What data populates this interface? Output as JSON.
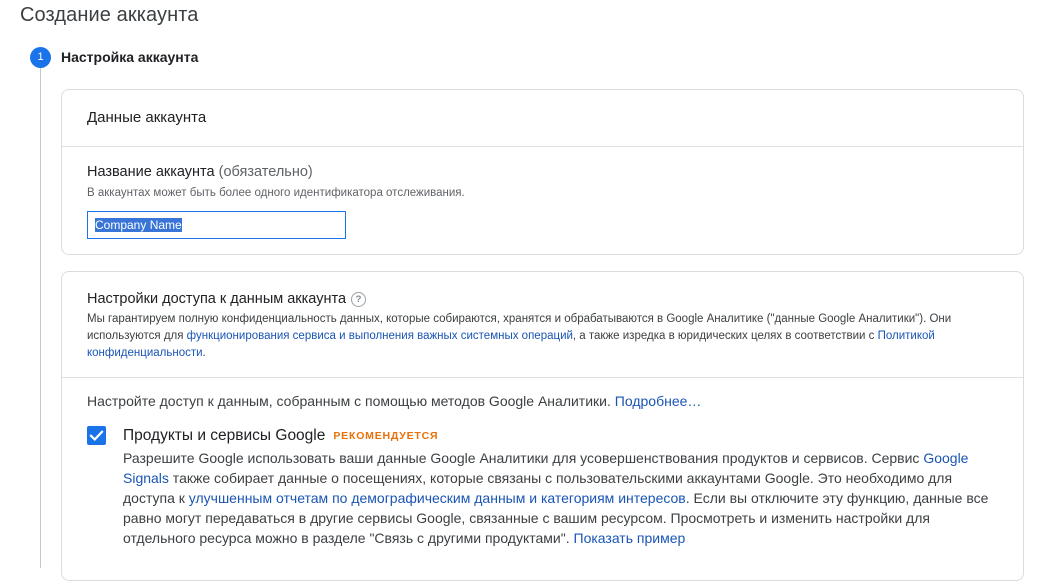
{
  "page": {
    "title": "Создание аккаунта"
  },
  "step": {
    "number": "1",
    "title": "Настройка аккаунта"
  },
  "account_card": {
    "header": "Данные аккаунта",
    "field_label": "Название аккаунта",
    "field_required": " (обязательно)",
    "field_hint": "В аккаунтах может быть более одного идентификатора отслеживания.",
    "field_value": "Company Name"
  },
  "sharing_card": {
    "title": "Настройки доступа к данным аккаунта",
    "help_icon_glyph": "?",
    "desc_part1": "Мы гарантируем полную конфиденциальность данных, которые собираются, хранятся и обрабатываются в Google Аналитике (\"данные Google Аналитики\"). Они используются для ",
    "desc_link1": "функционирования сервиса и выполнения важных системных операций",
    "desc_part2": ", а также изредка в юридических целях в соответствии с ",
    "desc_link2": "Политикой конфиденциальности",
    "desc_part3": ".",
    "configure_text": "Настройте доступ к данным, собранным с помощью методов Google Аналитики. ",
    "configure_link": "Подробнее…",
    "option": {
      "checked": true,
      "title": "Продукты и сервисы Google",
      "badge": "РЕКОМЕНДУЕТСЯ",
      "desc_part1": "Разрешите Google использовать ваши данные Google Аналитики для усовершенствования продуктов и сервисов. Сервис ",
      "desc_link1": "Google Signals",
      "desc_part2": " также собирает данные о посещениях, которые связаны с пользовательскими аккаунтами Google. Это необходимо для доступа к ",
      "desc_link2": "улучшенным отчетам по демографическим данным и категориям интересов",
      "desc_part3": ". Если вы отключите эту функцию, данные все равно могут передаваться в другие сервисы Google, связанные с вашим ресурсом. Просмотреть и изменить настройки для отдельного ресурса можно в разделе \"Связь с другими продуктами\". ",
      "desc_link3": "Показать пример"
    }
  },
  "colors": {
    "accent": "#1a73e8",
    "link": "#1a55b4",
    "badge": "#e8710a",
    "border": "#dadce0"
  },
  "icons": {
    "step": "step-number-circle",
    "help": "help-circle-icon",
    "checkbox": "checkmark-icon"
  }
}
